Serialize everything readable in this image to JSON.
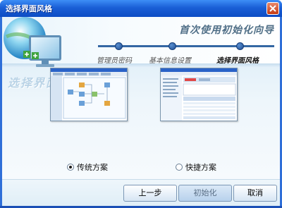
{
  "window": {
    "title": "选择界面风格"
  },
  "header": {
    "wizard_title": "首次使用初始化向导"
  },
  "steps": [
    {
      "label": "管理员密码",
      "active": false
    },
    {
      "label": "基本信息设置",
      "active": false
    },
    {
      "label": "选择界面风格",
      "active": true
    }
  ],
  "main": {
    "section_title": "选择界面风格"
  },
  "options": [
    {
      "label": "传统方案",
      "selected": true
    },
    {
      "label": "快捷方案",
      "selected": false
    }
  ],
  "buttons": {
    "prev": "上一步",
    "init": "初始化",
    "cancel": "取消"
  },
  "colors": {
    "title_bar": "#1a5fd6",
    "accent": "#3467a3",
    "close": "#c43a12"
  }
}
